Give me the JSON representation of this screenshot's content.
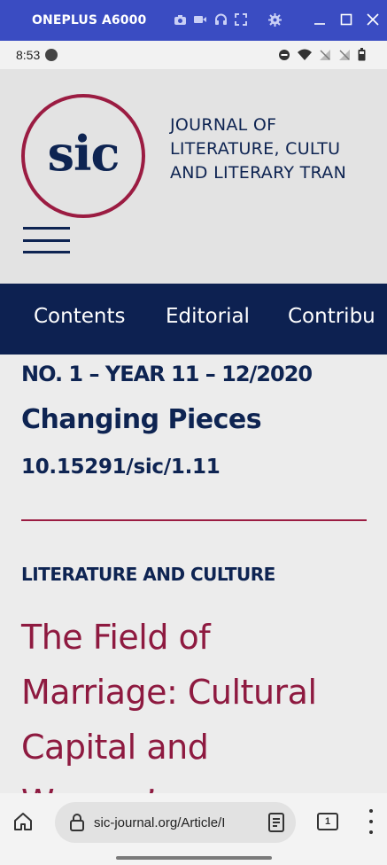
{
  "emulator": {
    "device_name": "ONEPLUS A6000",
    "icons": [
      "camera-icon",
      "video-icon",
      "headphones-icon",
      "fullscreen-icon",
      "settings-icon"
    ],
    "window_controls": [
      "minimize-icon",
      "maximize-icon",
      "close-icon"
    ]
  },
  "status_bar": {
    "time": "8:53",
    "icons": [
      "dnd-icon",
      "wifi-icon",
      "signal-icon",
      "signal-icon",
      "battery-icon"
    ]
  },
  "site": {
    "logo_text": "sic",
    "title_lines": [
      "JOURNAL OF",
      "LITERATURE, CULTU",
      "AND LITERARY TRAN"
    ],
    "nav": [
      "Contents",
      "Editorial",
      "Contribu"
    ]
  },
  "content": {
    "issue": "NO. 1 – YEAR 11 – 12/2020",
    "issue_title": "Changing Pieces",
    "doi": "10.15291/sic/1.11",
    "section": "LITERATURE AND CULTURE",
    "article_title_lines": [
      "The Field of",
      "Marriage: Cultural",
      "Capital and",
      "Women’s"
    ]
  },
  "browser": {
    "url": "sic-journal.org/Article/I",
    "tab_count": "1"
  },
  "colors": {
    "navy": "#0d2151",
    "crimson": "#9b1c42",
    "emulator_bar": "#3a4cc2"
  }
}
